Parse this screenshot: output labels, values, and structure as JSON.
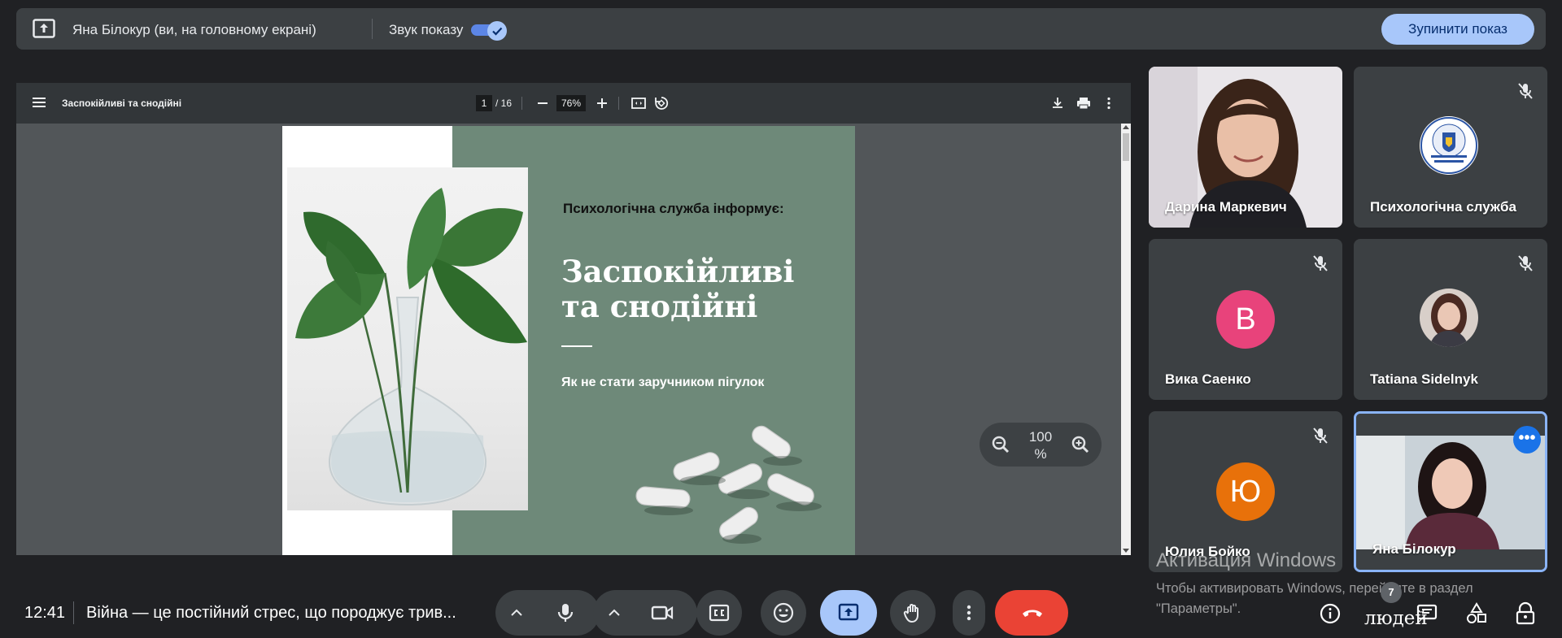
{
  "topbar": {
    "presenter_text": "Яна Білокур (ви, на головному екрані)",
    "sound_label": "Звук показу",
    "sound_toggle_on": true,
    "stop_button": "Зупинити показ",
    "accent_color": "#a8c7fa"
  },
  "pdf_viewer": {
    "doc_title": "Заспокійливі та снодійні",
    "current_page": "1",
    "page_total": "/ 16",
    "zoom": "76%",
    "icons": [
      "menu-icon",
      "zoom-out-icon",
      "zoom-in-icon",
      "fit-page-icon",
      "rotate-icon",
      "download-icon",
      "print-icon",
      "more-vert-icon"
    ]
  },
  "slide": {
    "subtitle": "Психологічна служба інформує:",
    "headline": "Заспокійливі та снодійні",
    "tagline": "Як не стати заручником пігулок",
    "background_color": "#6e8979"
  },
  "zoom_control": {
    "value_line1": "100",
    "value_line2": "%"
  },
  "participants": [
    {
      "name": "Дарина Маркевич",
      "muted": false,
      "type": "video"
    },
    {
      "name": "Психологічна служба",
      "muted": true,
      "type": "logo",
      "logo_text": "Психологічна Служба"
    },
    {
      "name": "Вика Саенко",
      "muted": true,
      "type": "letter",
      "letter": "В",
      "color": "#e8437b"
    },
    {
      "name": "Tatiana Sidelnyk",
      "muted": true,
      "type": "photo"
    },
    {
      "name": "Юлия Бойко",
      "muted": true,
      "type": "letter",
      "letter": "Ю",
      "color": "#e8710a"
    },
    {
      "name": "Яна Білокур",
      "muted": false,
      "type": "video",
      "active": true
    }
  ],
  "bottom": {
    "time": "12:41",
    "meeting_title": "Війна — це постійний стрес, що породжує трив...",
    "controls": [
      "chevron-up-icon",
      "microphone-icon",
      "chevron-up-icon",
      "camera-icon",
      "captions-icon",
      "emoji-icon",
      "present-icon",
      "raise-hand-icon",
      "more-vert-icon",
      "end-call-icon"
    ],
    "end_call_color": "#ea4335",
    "people_count": "7",
    "people_label": "людей",
    "right_icons": [
      "info-icon",
      "people-icon",
      "chat-icon",
      "activities-icon",
      "host-controls-icon"
    ]
  },
  "watermark": {
    "title": "Активация Windows",
    "text": "Чтобы активировать Windows, перейдите в раздел \"Параметры\"."
  }
}
